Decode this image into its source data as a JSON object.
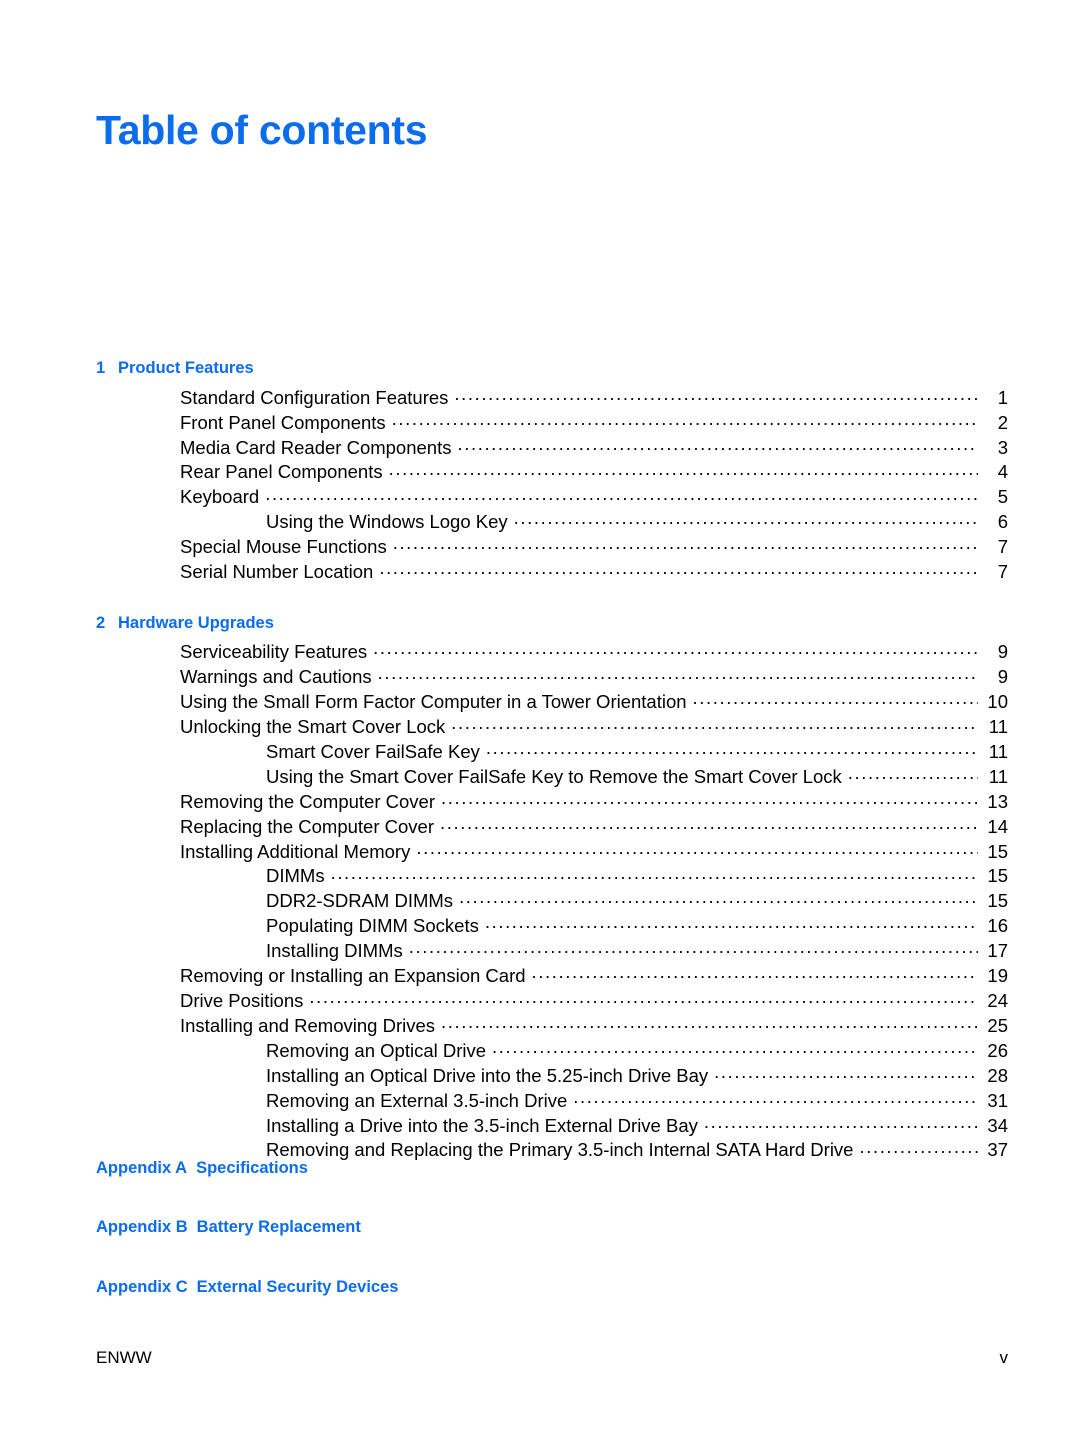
{
  "document": {
    "title": "Table of contents",
    "accent_color": "#0b6cec",
    "text_color": "#000000",
    "background_color": "#ffffff"
  },
  "chapters": [
    {
      "number": "1",
      "label": "Product Features",
      "entries": [
        {
          "text": "Standard Configuration Features",
          "page": "1",
          "level": 1
        },
        {
          "text": "Front Panel Components",
          "page": "2",
          "level": 1
        },
        {
          "text": "Media Card Reader Components",
          "page": "3",
          "level": 1
        },
        {
          "text": "Rear Panel Components",
          "page": "4",
          "level": 1
        },
        {
          "text": "Keyboard",
          "page": "5",
          "level": 1
        },
        {
          "text": "Using the Windows Logo Key",
          "page": "6",
          "level": 2
        },
        {
          "text": "Special Mouse Functions",
          "page": "7",
          "level": 1
        },
        {
          "text": "Serial Number Location",
          "page": "7",
          "level": 1
        }
      ]
    },
    {
      "number": "2",
      "label": "Hardware Upgrades",
      "entries": [
        {
          "text": "Serviceability Features",
          "page": "9",
          "level": 1
        },
        {
          "text": "Warnings and Cautions",
          "page": "9",
          "level": 1
        },
        {
          "text": "Using the Small Form Factor Computer in a Tower Orientation",
          "page": "10",
          "level": 1
        },
        {
          "text": "Unlocking the Smart Cover Lock",
          "page": "11",
          "level": 1
        },
        {
          "text": "Smart Cover FailSafe Key",
          "page": "11",
          "level": 2
        },
        {
          "text": "Using the Smart Cover FailSafe Key to Remove the Smart Cover Lock",
          "page": "11",
          "level": 2
        },
        {
          "text": "Removing the Computer Cover",
          "page": "13",
          "level": 1
        },
        {
          "text": "Replacing the Computer Cover",
          "page": "14",
          "level": 1
        },
        {
          "text": "Installing Additional Memory",
          "page": "15",
          "level": 1
        },
        {
          "text": "DIMMs",
          "page": "15",
          "level": 2
        },
        {
          "text": "DDR2-SDRAM DIMMs",
          "page": "15",
          "level": 2
        },
        {
          "text": "Populating DIMM Sockets",
          "page": "16",
          "level": 2
        },
        {
          "text": "Installing DIMMs",
          "page": "17",
          "level": 2
        },
        {
          "text": "Removing or Installing an Expansion Card",
          "page": "19",
          "level": 1
        },
        {
          "text": "Drive Positions",
          "page": "24",
          "level": 1
        },
        {
          "text": "Installing and Removing Drives",
          "page": "25",
          "level": 1
        },
        {
          "text": "Removing an Optical Drive",
          "page": "26",
          "level": 2
        },
        {
          "text": "Installing an Optical Drive into the 5.25-inch Drive Bay",
          "page": "28",
          "level": 2
        },
        {
          "text": "Removing an External 3.5-inch Drive",
          "page": "31",
          "level": 2
        },
        {
          "text": "Installing a Drive into the 3.5-inch External Drive Bay",
          "page": "34",
          "level": 2
        },
        {
          "text": "Removing and Replacing the Primary 3.5-inch Internal SATA Hard Drive",
          "page": "37",
          "level": 2
        }
      ]
    }
  ],
  "appendices": [
    {
      "number": "Appendix A",
      "label": "Specifications"
    },
    {
      "number": "Appendix B",
      "label": "Battery Replacement"
    },
    {
      "number": "Appendix C",
      "label": "External Security Devices"
    }
  ],
  "footer": {
    "left": "ENWW",
    "right": "v"
  }
}
